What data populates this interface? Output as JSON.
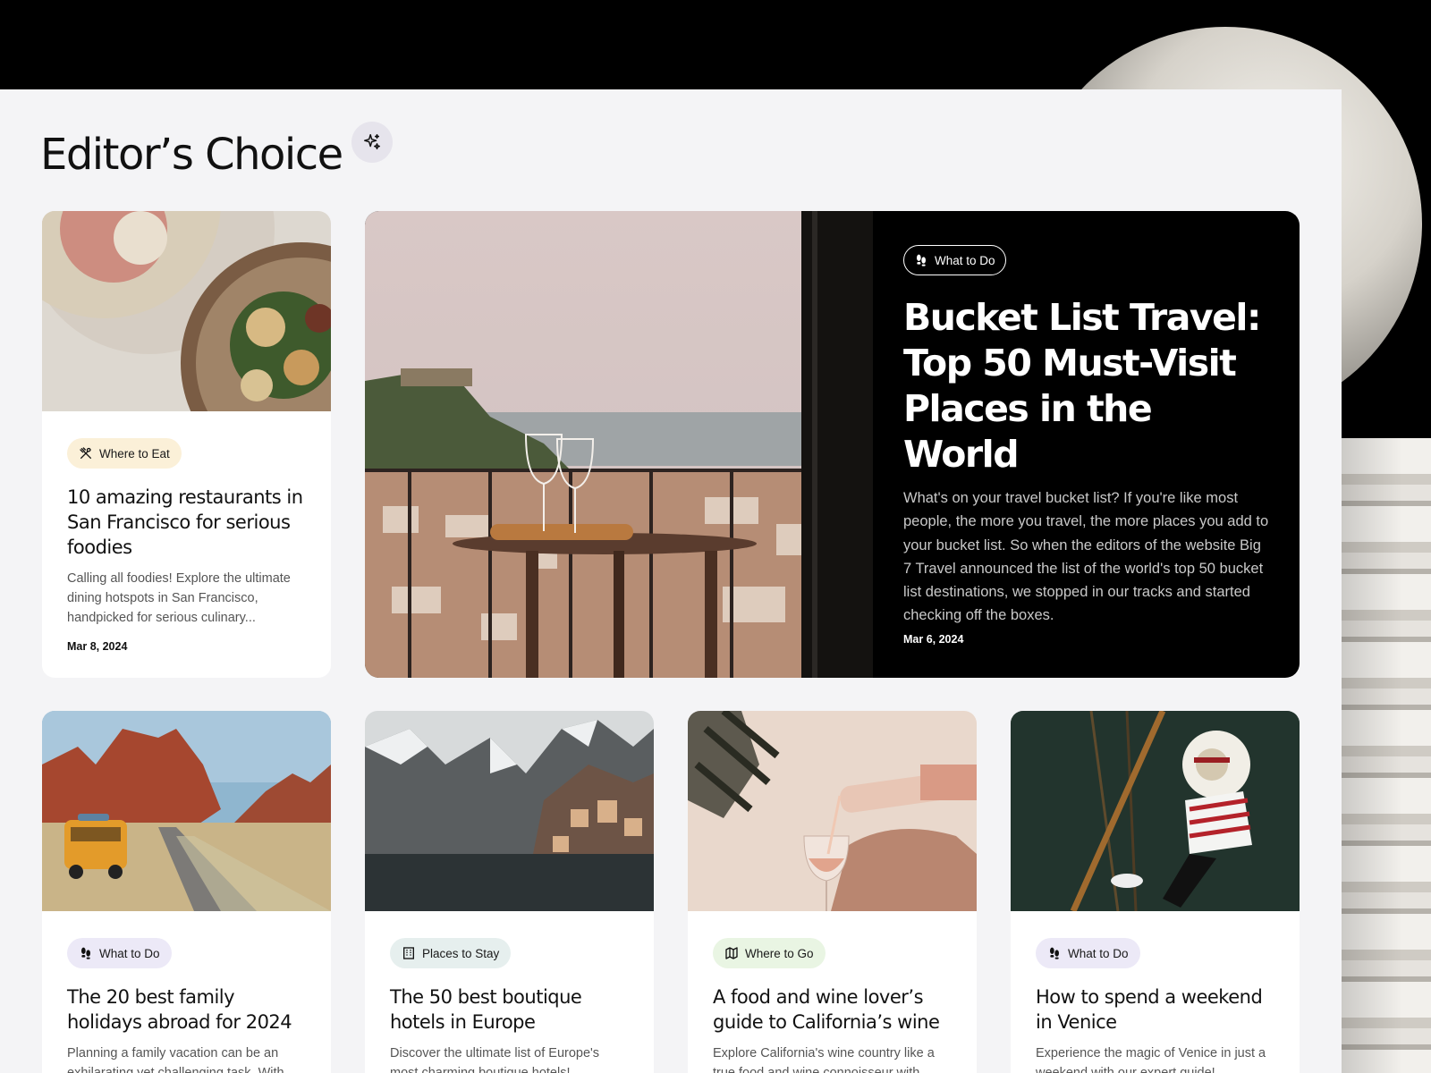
{
  "page": {
    "title": "Editor’s Choice"
  },
  "featured": {
    "tag": "What to Do",
    "title_lines": [
      "Bucket List Travel:",
      "Top 50 Must-Visit",
      "Places in the World"
    ],
    "description": "What's on your travel bucket list? If you're like most people, the more you travel, the more places you add to your bucket list. So when the editors of the website Big 7 Travel announced the list of the world's top 50 bucket list destinations, we stopped in our tracks and started checking off the boxes.",
    "date": "Mar 6, 2024"
  },
  "cards": [
    {
      "tag": "Where to Eat",
      "title": "10 amazing restaurants in San Francisco for serious foodies",
      "description": "Calling all foodies! Explore the ultimate dining hotspots in San Francisco, handpicked for serious culinary...",
      "date": "Mar 8, 2024",
      "tag_color": "#fbf0d8"
    },
    {
      "tag": "What to Do",
      "title": "The 20 best family holidays abroad for 2024",
      "description": "Planning a family vacation can be an exhilarating yet challenging task. With",
      "tag_color": "#ece9f7"
    },
    {
      "tag": "Places to Stay",
      "title": "The 50 best boutique hotels in Europe",
      "description": "Discover the ultimate list of Europe's most charming boutique hotels!",
      "tag_color": "#e6efee"
    },
    {
      "tag": "Where to Go",
      "title": "A food and wine lover’s guide to California’s wine",
      "description": "Explore California's wine country like a true food and wine connoisseur with",
      "tag_color": "#e9f5e3"
    },
    {
      "tag": "What to Do",
      "title": "How to spend a weekend in Venice",
      "description": "Experience the magic of Venice in just a weekend with our expert guide!",
      "tag_color": "#ece9f7"
    }
  ],
  "icons": {
    "sparkle": "sparkle-icon",
    "eat": "utensils-icon",
    "do": "footprints-icon",
    "stay": "building-icon",
    "go": "map-icon"
  }
}
